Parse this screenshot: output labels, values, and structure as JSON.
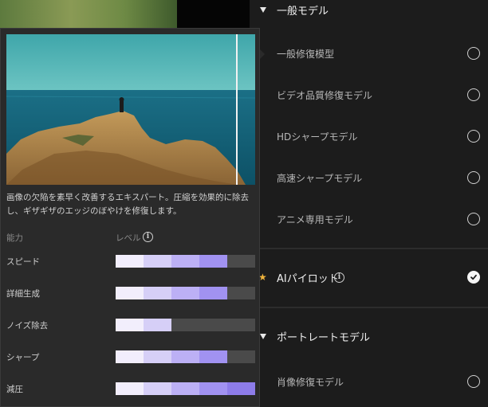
{
  "right_panel": {
    "general_section": {
      "title": "一般モデル"
    },
    "general_models": [
      {
        "label": "一般修復模型",
        "selected": false
      },
      {
        "label": "ビデオ品質修復モデル",
        "selected": false
      },
      {
        "label": "HDシャープモデル",
        "selected": false
      },
      {
        "label": "高速シャープモデル",
        "selected": false
      },
      {
        "label": "アニメ専用モデル",
        "selected": false
      }
    ],
    "ai_pilot": {
      "label": "AIパイロット",
      "selected": true,
      "star_icon": "star-icon",
      "info_icon": "info-icon"
    },
    "portrait_section": {
      "title": "ポートレートモデル"
    },
    "portrait_models": [
      {
        "label": "肖像修復モデル",
        "selected": false
      }
    ]
  },
  "tooltip": {
    "description": "画像の欠陥を素早く改善するエキスパート。圧縮を効果的に除去し、ギザギザのエッジのぼやけを修復します。",
    "header_ability": "能力",
    "header_level": "レベル",
    "max_level": 5,
    "abilities": [
      {
        "label": "スピード",
        "level": 4
      },
      {
        "label": "詳細生成",
        "level": 4
      },
      {
        "label": "ノイズ除去",
        "level": 2
      },
      {
        "label": "シャープ",
        "level": 4
      },
      {
        "label": "減圧",
        "level": 5
      }
    ]
  },
  "colors": {
    "level_segments": [
      "#f2eefc",
      "#d6cff7",
      "#bcb0f5",
      "#a192f1",
      "#8d7ce9"
    ],
    "empty_segment": "#4a4a4a",
    "star": "#f0b43c"
  }
}
